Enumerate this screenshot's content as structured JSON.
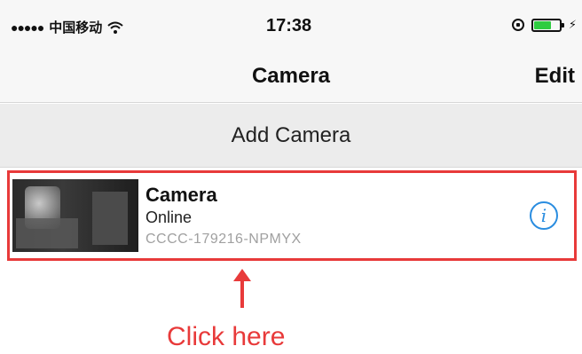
{
  "status_bar": {
    "signal_dots": "●●●●●",
    "carrier": "中国移动",
    "time": "17:38",
    "battery_level": 0.7,
    "charging_symbol": "⚡"
  },
  "nav": {
    "title": "Camera",
    "edit_label": "Edit"
  },
  "add_camera": {
    "label": "Add Camera"
  },
  "camera": {
    "name": "Camera",
    "status": "Online",
    "uid": "CCCC-179216-NPMYX",
    "info_symbol": "i"
  },
  "annotation": {
    "text": "Click here",
    "color": "#e83a3a"
  },
  "colors": {
    "accent": "#2a8de0",
    "highlight": "#e83a3a"
  }
}
